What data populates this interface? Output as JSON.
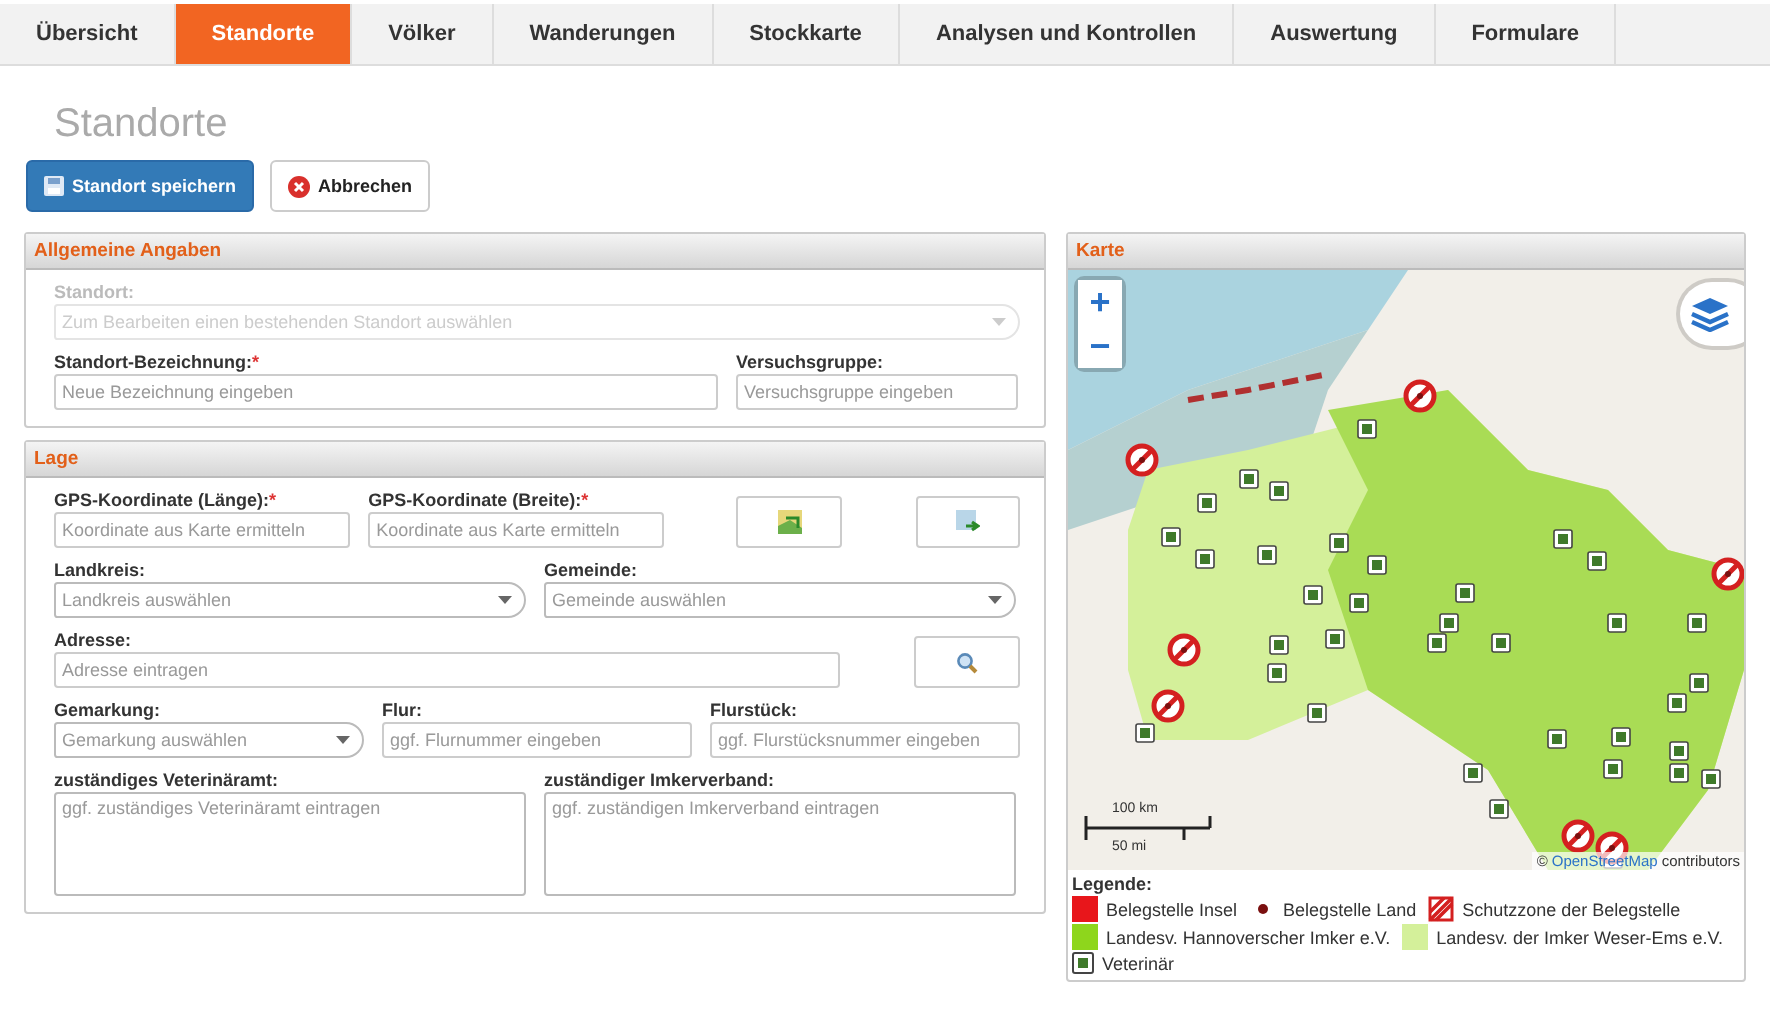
{
  "tabs": [
    {
      "label": "Übersicht",
      "selected": false
    },
    {
      "label": "Standorte",
      "selected": true
    },
    {
      "label": "Völker",
      "selected": false
    },
    {
      "label": "Wanderungen",
      "selected": false
    },
    {
      "label": "Stockkarte",
      "selected": false
    },
    {
      "label": "Analysen und Kontrollen",
      "selected": false
    },
    {
      "label": "Auswertung",
      "selected": false
    },
    {
      "label": "Formulare",
      "selected": false
    }
  ],
  "page_title": "Standorte",
  "actions": {
    "save": "Standort speichern",
    "cancel": "Abbrechen"
  },
  "general": {
    "title": "Allgemeine Angaben",
    "standort": {
      "label": "Standort:",
      "placeholder": "Zum Bearbeiten einen bestehenden Standort auswählen",
      "disabled": true
    },
    "name": {
      "label": "Standort-Bezeichnung:",
      "required_mark": "*",
      "placeholder": "Neue Bezeichnung eingeben"
    },
    "group": {
      "label": "Versuchsgruppe:",
      "placeholder": "Versuchsgruppe eingeben"
    }
  },
  "location": {
    "title": "Lage",
    "gps_long": {
      "label": "GPS-Koordinate (Länge):",
      "required_mark": "*",
      "placeholder": "Koordinate aus Karte ermitteln"
    },
    "gps_lat": {
      "label": "GPS-Koordinate (Breite):",
      "required_mark": "*",
      "placeholder": "Koordinate aus Karte ermitteln"
    },
    "district": {
      "label": "Landkreis:",
      "placeholder": "Landkreis auswählen"
    },
    "municipality": {
      "label": "Gemeinde:",
      "placeholder": "Gemeinde auswählen"
    },
    "address": {
      "label": "Adresse:",
      "placeholder": "Adresse eintragen"
    },
    "gemarkung": {
      "label": "Gemarkung:",
      "placeholder": "Gemarkung auswählen"
    },
    "flur": {
      "label": "Flur:",
      "placeholder": "ggf. Flurnummer eingeben"
    },
    "flurstueck": {
      "label": "Flurstück:",
      "placeholder": "ggf. Flurstücksnummer eingeben"
    },
    "vet": {
      "label": "zuständiges Veterinäramt:",
      "placeholder": "ggf. zuständiges Veterinäramt eintragen"
    },
    "association": {
      "label": "zuständiger Imkerverband:",
      "placeholder": "ggf. zuständigen Imkerverband eintragen"
    }
  },
  "map": {
    "title": "Karte",
    "zoom_in": "+",
    "zoom_out": "−",
    "scale_km": "100 km",
    "scale_mi": "50 mi",
    "attribution_prefix": "©",
    "attribution_link": "OpenStreetMap",
    "attribution_suffix": "contributors",
    "legend_title": "Legende:",
    "legend": [
      {
        "kind": "swatch",
        "color": "#e8161b",
        "label": "Belegstelle Insel"
      },
      {
        "kind": "dot",
        "color": "#7a1010",
        "label": "Belegstelle Land"
      },
      {
        "kind": "hatch",
        "color": "#d42020",
        "label": "Schutzzone der Belegstelle"
      },
      {
        "kind": "swatch",
        "color": "#8ed61c",
        "label": "Landesv. Hannoverscher Imker e.V."
      },
      {
        "kind": "swatch",
        "color": "#d4f09a",
        "label": "Landesv. der Imker Weser-Ems e.V."
      },
      {
        "kind": "vet",
        "color": "#3f7a2a",
        "label": "Veterinär"
      }
    ]
  }
}
